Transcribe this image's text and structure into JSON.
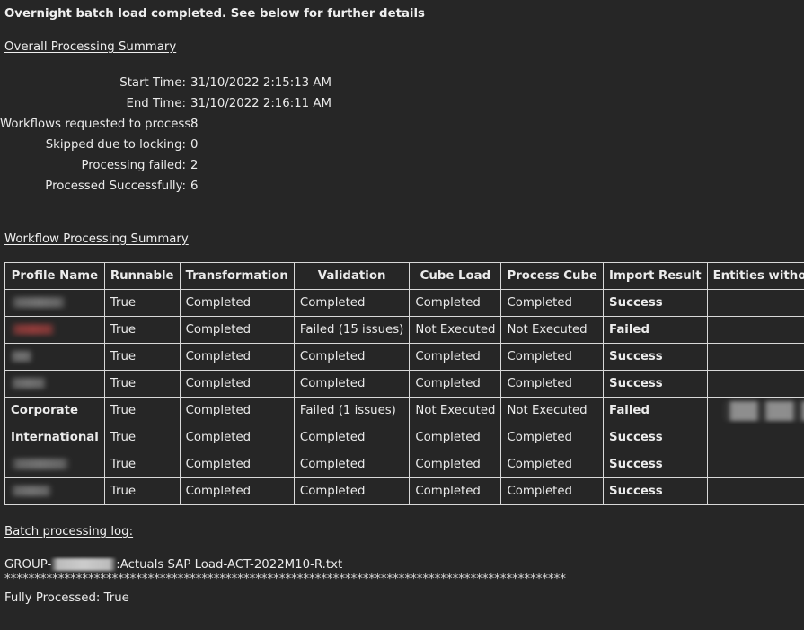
{
  "report": {
    "intro_line": "Overnight batch load completed. See below for further details",
    "heading_overall": "Overall Processing Summary",
    "heading_workflow": "Workflow Processing Summary",
    "heading_log": "Batch processing log:"
  },
  "colors": {
    "background": "#262626",
    "text": "#ebebeb",
    "failed_red": "#e8403f",
    "table_border": "#d8d8d8"
  },
  "summary": {
    "rows": [
      {
        "label": "Start Time:",
        "value": "31/10/2022 2:15:13 AM"
      },
      {
        "label": "End Time:",
        "value": "31/10/2022 2:16:11 AM"
      },
      {
        "label": "Workflows requested to process:",
        "value": "8"
      },
      {
        "label": "Skipped due to locking:",
        "value": "0"
      },
      {
        "label": "Processing failed:",
        "value": "2"
      },
      {
        "label": "Processed Successfully:",
        "value": "6"
      }
    ]
  },
  "table": {
    "columns": [
      "Profile Name",
      "Runnable",
      "Transformation",
      "Validation",
      "Cube Load",
      "Process Cube",
      "Import Result",
      "Entities without Files:"
    ],
    "rows": [
      {
        "profile": "",
        "profile_state": "redacted",
        "runnable": "True",
        "transformation": "Completed",
        "validation": "Completed",
        "cube_load": "Completed",
        "process_cube": "Completed",
        "import_result": "Success",
        "entities": "",
        "entities_state": "empty"
      },
      {
        "profile": "",
        "profile_state": "redacted-red",
        "runnable": "True",
        "transformation": "Completed",
        "validation": "Failed (15 issues)",
        "cube_load": "Not Executed",
        "process_cube": "Not Executed",
        "import_result": "Failed",
        "entities": "",
        "entities_state": "empty"
      },
      {
        "profile": "",
        "profile_state": "redacted",
        "runnable": "True",
        "transformation": "Completed",
        "validation": "Completed",
        "cube_load": "Completed",
        "process_cube": "Completed",
        "import_result": "Success",
        "entities": "",
        "entities_state": "empty"
      },
      {
        "profile": "",
        "profile_state": "redacted",
        "runnable": "True",
        "transformation": "Completed",
        "validation": "Completed",
        "cube_load": "Completed",
        "process_cube": "Completed",
        "import_result": "Success",
        "entities": "",
        "entities_state": "empty"
      },
      {
        "profile": "Corporate",
        "profile_state": "red",
        "runnable": "True",
        "transformation": "Completed",
        "validation": "Failed (1 issues)",
        "cube_load": "Not Executed",
        "process_cube": "Not Executed",
        "import_result": "Failed",
        "entities": "",
        "entities_state": "redacted"
      },
      {
        "profile": "International",
        "profile_state": "white",
        "runnable": "True",
        "transformation": "Completed",
        "validation": "Completed",
        "cube_load": "Completed",
        "process_cube": "Completed",
        "import_result": "Success",
        "entities": "",
        "entities_state": "empty"
      },
      {
        "profile": "",
        "profile_state": "redacted",
        "runnable": "True",
        "transformation": "Completed",
        "validation": "Completed",
        "cube_load": "Completed",
        "process_cube": "Completed",
        "import_result": "Success",
        "entities": "",
        "entities_state": "empty"
      },
      {
        "profile": "",
        "profile_state": "redacted",
        "runnable": "True",
        "transformation": "Completed",
        "validation": "Completed",
        "cube_load": "Completed",
        "process_cube": "Completed",
        "import_result": "Success",
        "entities": "",
        "entities_state": "empty"
      }
    ]
  },
  "log": {
    "file_prefix": "GROUP-",
    "file_suffix": ":Actuals SAP Load-ACT-2022M10-R.txt",
    "separator": "********************************************************************************************************************",
    "fully_processed_line": "Fully Processed: True"
  }
}
